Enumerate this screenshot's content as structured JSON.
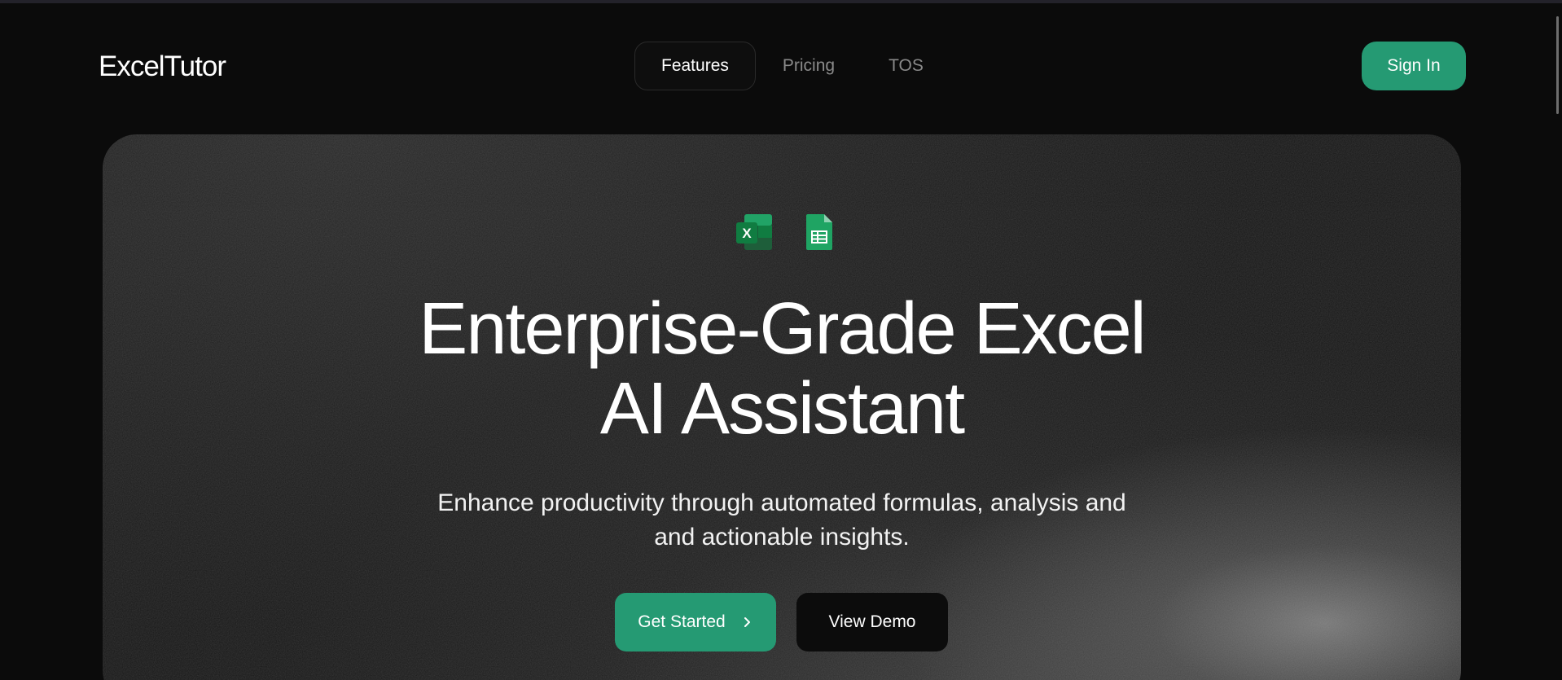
{
  "header": {
    "logo": "ExcelTutor",
    "nav": [
      {
        "label": "Features",
        "active": true
      },
      {
        "label": "Pricing",
        "active": false
      },
      {
        "label": "TOS",
        "active": false
      }
    ],
    "sign_in_label": "Sign In"
  },
  "hero": {
    "icons": [
      "excel-icon",
      "google-sheets-icon"
    ],
    "headline_line1": "Enterprise-Grade Excel",
    "headline_line2": "AI Assistant",
    "subtitle_line1": "Enhance productivity through automated formulas, analysis and",
    "subtitle_line2": "and actionable insights.",
    "primary_cta": "Get Started",
    "primary_cta_icon": "chevron-right-icon",
    "secondary_cta": "View Demo"
  },
  "colors": {
    "background": "#0b0b0b",
    "accent": "#259a73",
    "excel_green": "#1e7145",
    "sheets_green": "#1fa463"
  }
}
